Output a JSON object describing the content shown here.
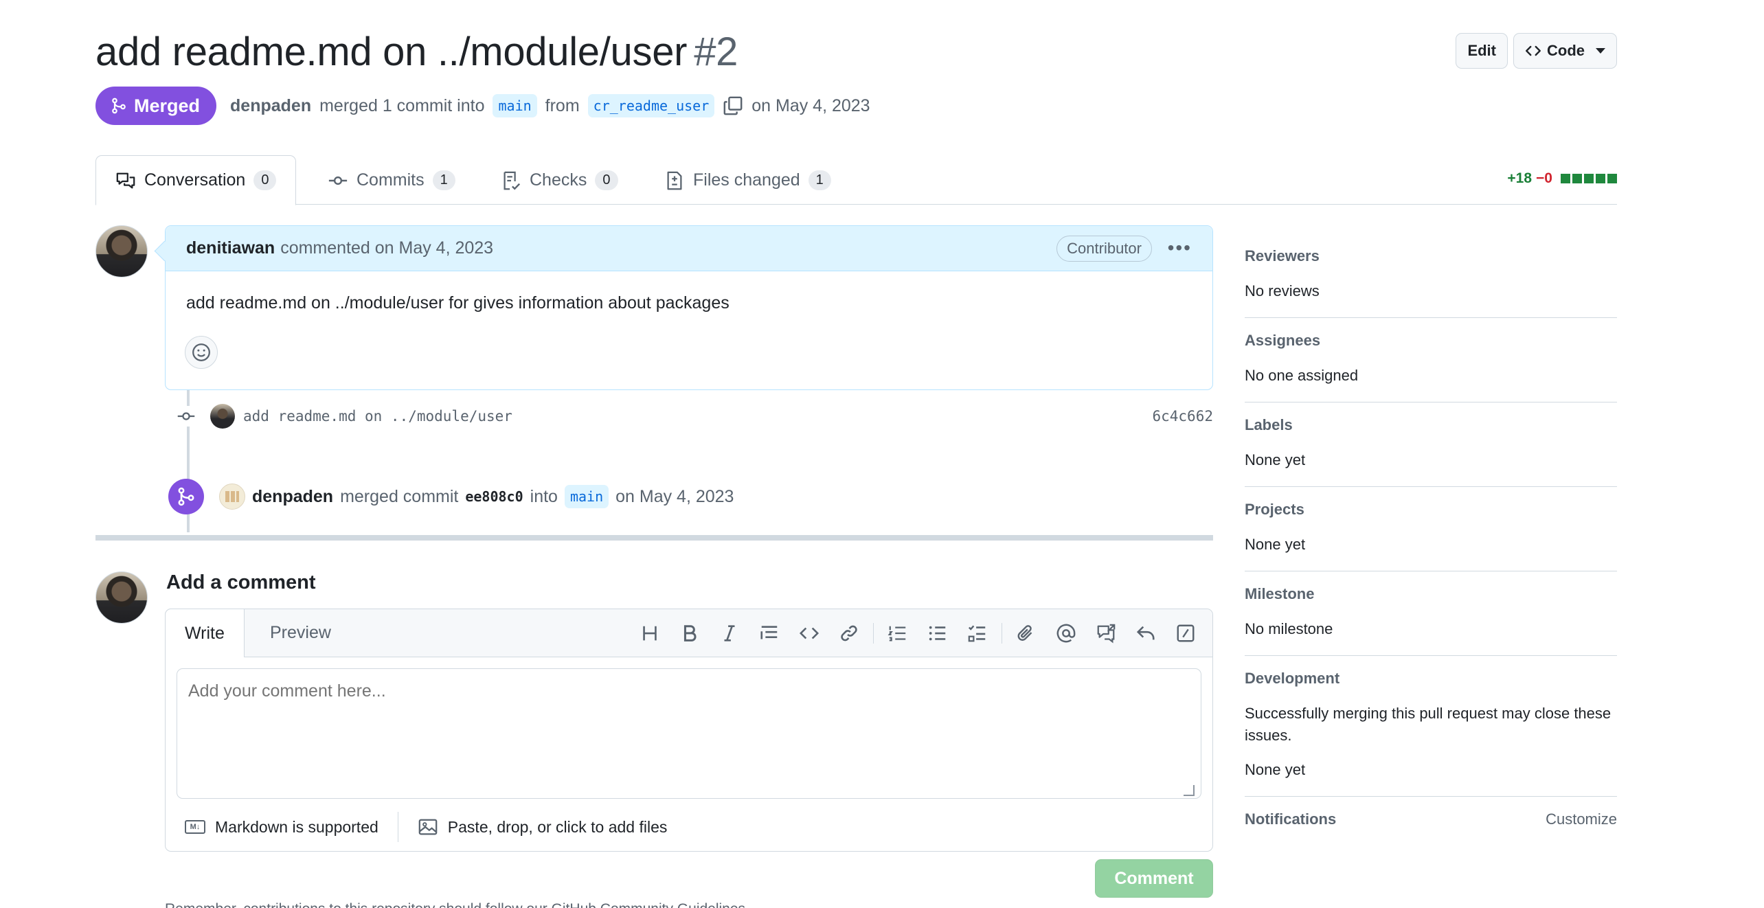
{
  "pr": {
    "title": "add readme.md on ../module/user",
    "number": "#2",
    "status": "Merged",
    "author": "denpaden",
    "merged_text": "merged 1 commit into",
    "base_branch": "main",
    "from_text": "from",
    "head_branch": "cr_readme_user",
    "date_text": "on May 4, 2023"
  },
  "header_buttons": {
    "edit": "Edit",
    "code": "Code"
  },
  "tabs": [
    {
      "label": "Conversation",
      "count": "0"
    },
    {
      "label": "Commits",
      "count": "1"
    },
    {
      "label": "Checks",
      "count": "0"
    },
    {
      "label": "Files changed",
      "count": "1"
    }
  ],
  "diffstat": {
    "additions": "+18",
    "deletions": "−0"
  },
  "comment": {
    "author": "denitiawan",
    "action": "commented on May 4, 2023",
    "role": "Contributor",
    "body": "add readme.md on ../module/user for gives information about packages"
  },
  "commit": {
    "message": "add readme.md on ../module/user",
    "sha": "6c4c662"
  },
  "merge_event": {
    "user": "denpaden",
    "text1": "merged commit",
    "sha": "ee808c0",
    "text2": "into",
    "branch": "main",
    "date": "on May 4, 2023"
  },
  "add_comment": {
    "title": "Add a comment",
    "write_tab": "Write",
    "preview_tab": "Preview",
    "placeholder": "Add your comment here...",
    "markdown_note": "Markdown is supported",
    "attach_note": "Paste, drop, or click to add files",
    "submit": "Comment",
    "tip": "Remember, contributions to this repository should follow our GitHub Community Guidelines."
  },
  "sidebar": {
    "reviewers": {
      "label": "Reviewers",
      "value": "No reviews"
    },
    "assignees": {
      "label": "Assignees",
      "value": "No one assigned"
    },
    "labels": {
      "label": "Labels",
      "value": "None yet"
    },
    "projects": {
      "label": "Projects",
      "value": "None yet"
    },
    "milestone": {
      "label": "Milestone",
      "value": "No milestone"
    },
    "development": {
      "label": "Development",
      "desc": "Successfully merging this pull request may close these issues.",
      "value": "None yet"
    },
    "notifications": {
      "label": "Notifications",
      "action": "Customize"
    }
  },
  "colors": {
    "merged": "#8250df",
    "branch_bg": "#ddf4ff",
    "branch_fg": "#0969da",
    "additions": "#1a7f37",
    "deletions": "#d1242f"
  }
}
